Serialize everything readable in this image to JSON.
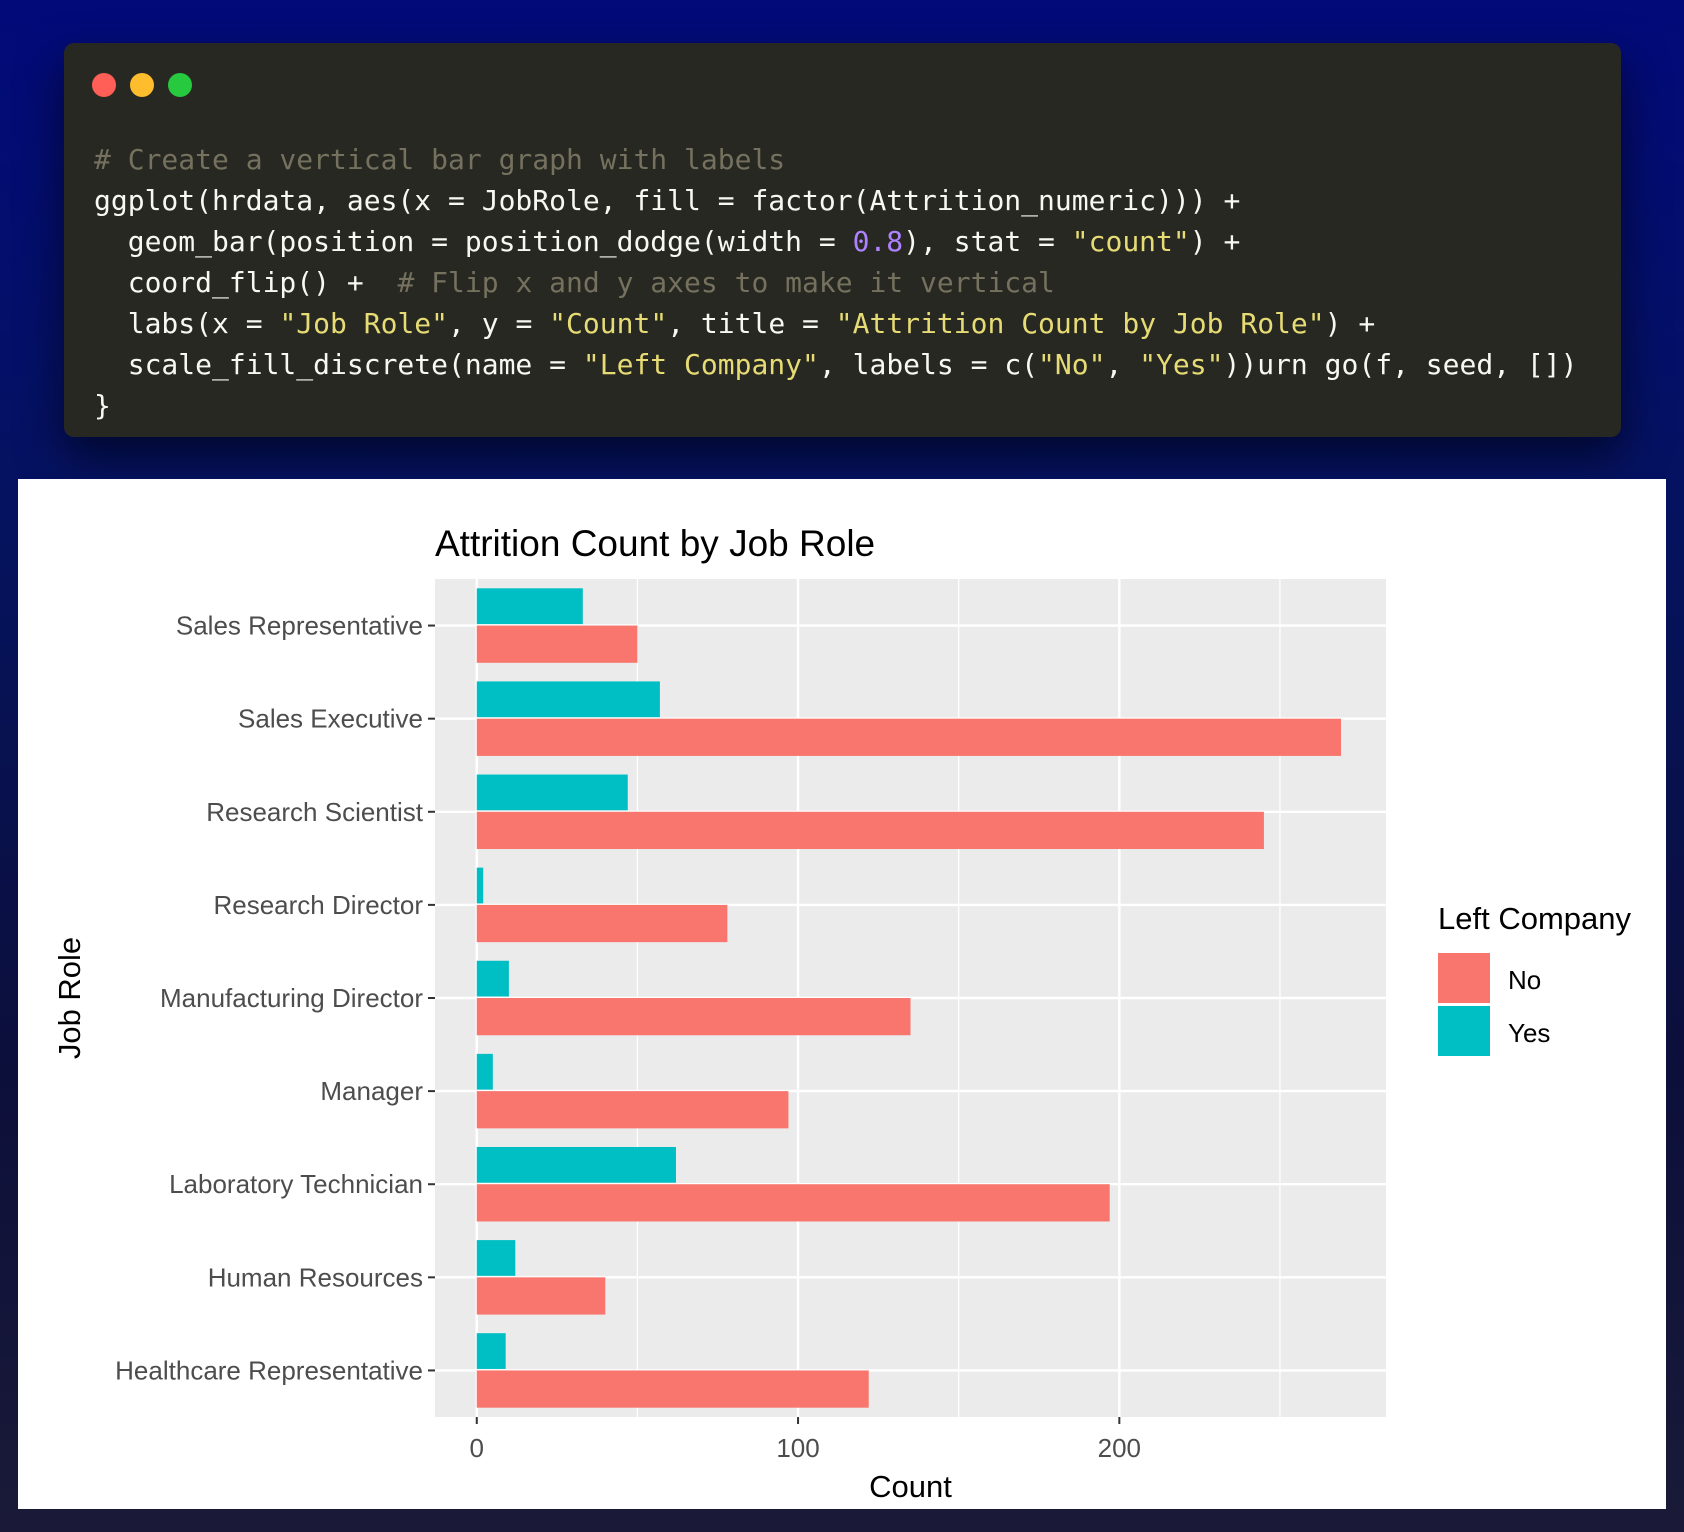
{
  "window": {
    "controls": [
      "close",
      "minimize",
      "maximize"
    ]
  },
  "code": {
    "lines": [
      [
        {
          "t": "# Create a vertical bar graph with labels",
          "c": "com"
        }
      ],
      [
        {
          "t": "ggplot(hrdata, aes(x = JobRole, fill = factor(Attrition_numeric))) +",
          "c": ""
        }
      ],
      [
        {
          "t": "  geom_bar(position = position_dodge(width = ",
          "c": ""
        },
        {
          "t": "0.8",
          "c": "num"
        },
        {
          "t": "), stat = ",
          "c": ""
        },
        {
          "t": "\"count\"",
          "c": "str"
        },
        {
          "t": ") +",
          "c": ""
        }
      ],
      [
        {
          "t": "  coord_flip() +  ",
          "c": ""
        },
        {
          "t": "# Flip x and y axes to make it vertical",
          "c": "com"
        }
      ],
      [
        {
          "t": "  labs(x = ",
          "c": ""
        },
        {
          "t": "\"Job Role\"",
          "c": "str"
        },
        {
          "t": ", y = ",
          "c": ""
        },
        {
          "t": "\"Count\"",
          "c": "str"
        },
        {
          "t": ", title = ",
          "c": ""
        },
        {
          "t": "\"Attrition Count by Job Role\"",
          "c": "str"
        },
        {
          "t": ") +",
          "c": ""
        }
      ],
      [
        {
          "t": "  scale_fill_discrete(name = ",
          "c": ""
        },
        {
          "t": "\"Left Company\"",
          "c": "str"
        },
        {
          "t": ", labels = c(",
          "c": ""
        },
        {
          "t": "\"No\"",
          "c": "str"
        },
        {
          "t": ", ",
          "c": ""
        },
        {
          "t": "\"Yes\"",
          "c": "str"
        },
        {
          "t": "))urn go(f, seed, [])",
          "c": ""
        }
      ],
      [
        {
          "t": "}",
          "c": ""
        }
      ]
    ]
  },
  "chart_data": {
    "type": "bar",
    "orientation": "horizontal",
    "title": "Attrition Count by Job Role",
    "xlabel": "Count",
    "ylabel": "Job Role",
    "categories": [
      "Healthcare Representative",
      "Human Resources",
      "Laboratory Technician",
      "Manager",
      "Manufacturing Director",
      "Research Director",
      "Research Scientist",
      "Sales Executive",
      "Sales Representative"
    ],
    "series": [
      {
        "name": "No",
        "color": "#F8766D",
        "values": [
          122,
          40,
          197,
          97,
          135,
          78,
          245,
          269,
          50
        ]
      },
      {
        "name": "Yes",
        "color": "#00BFC4",
        "values": [
          9,
          12,
          62,
          5,
          10,
          2,
          47,
          57,
          33
        ]
      }
    ],
    "xlim": [
      -13,
      283
    ],
    "xticks": [
      0,
      100,
      200
    ],
    "legend": {
      "title": "Left Company",
      "position": "right"
    },
    "grid": true,
    "panel_background": "#EBEBEB"
  }
}
